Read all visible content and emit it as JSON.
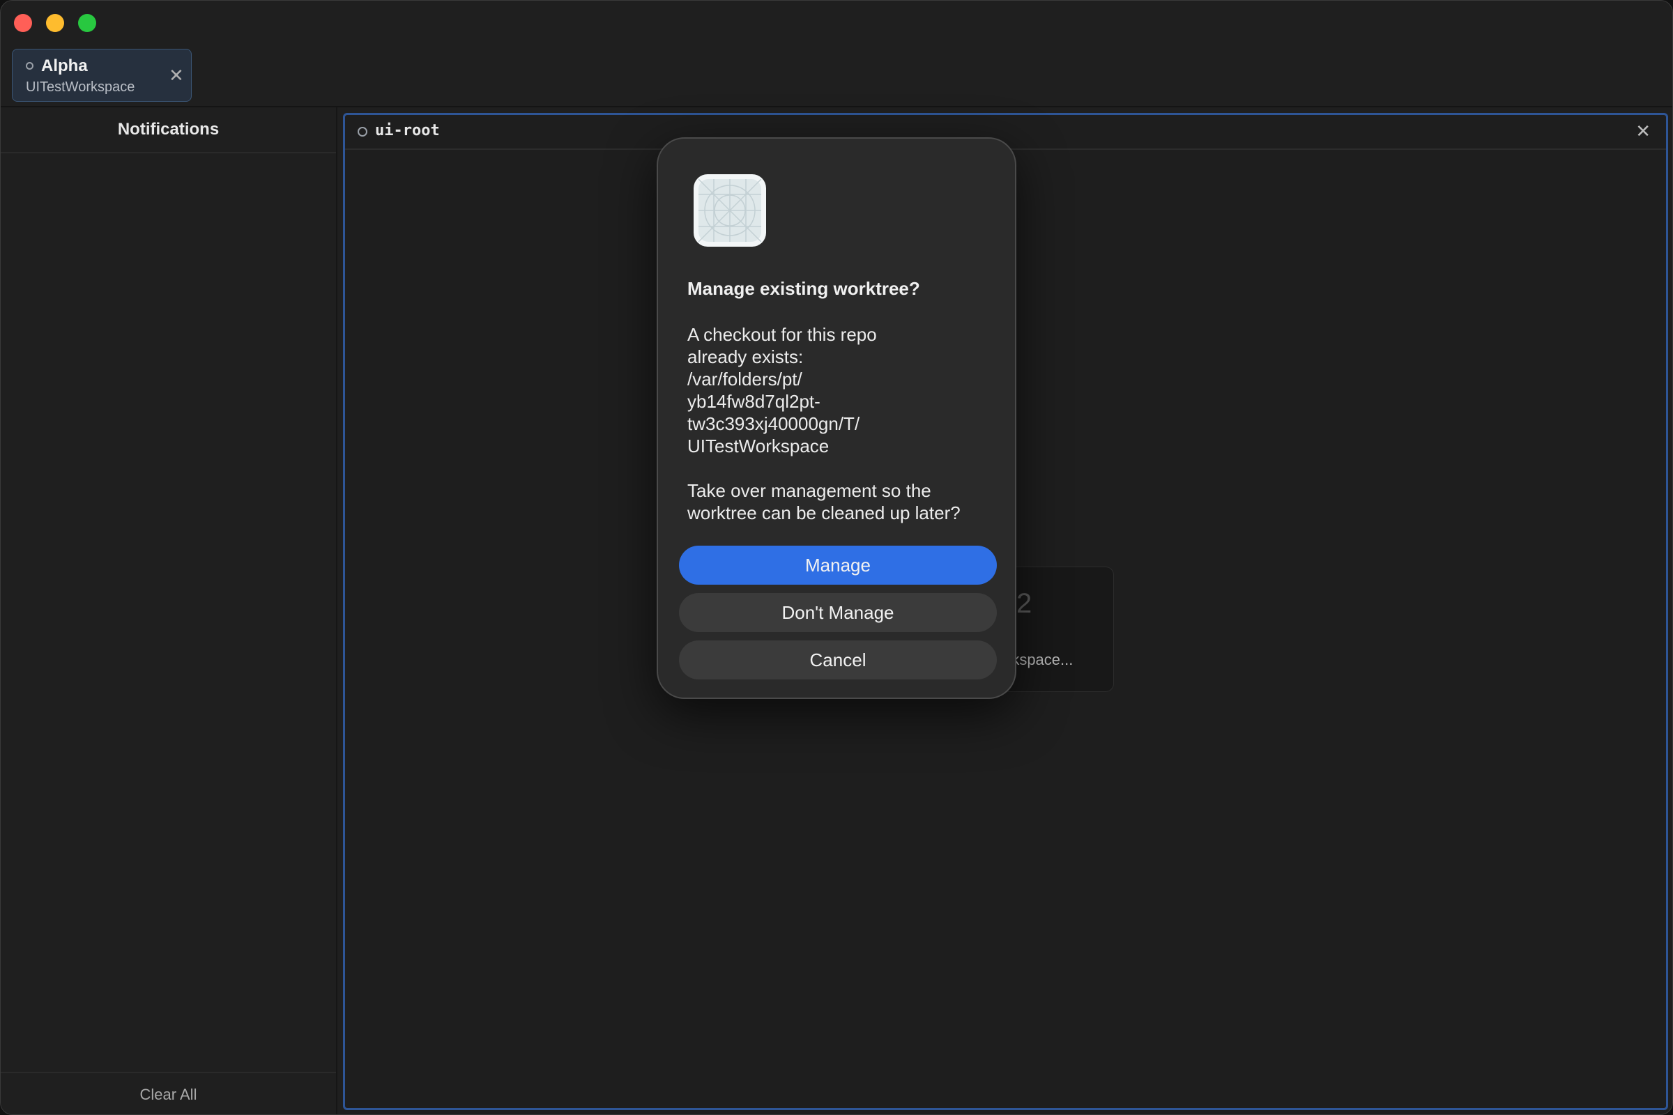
{
  "window": {
    "controls": [
      "close",
      "minimize",
      "maximize"
    ]
  },
  "workspace_tab": {
    "title": "Alpha",
    "subtitle": "UITestWorkspace",
    "close_glyph": "✕"
  },
  "sidebar": {
    "header": "Notifications",
    "footer_button": "Clear All"
  },
  "pane": {
    "name": "ui-root",
    "close_glyph": "✕",
    "background_card_text": "rkspace...",
    "background_card_glyph": "2"
  },
  "dialog": {
    "icon": "app-placeholder-icon",
    "title": "Manage existing worktree?",
    "message": "A checkout for this repo\nalready exists:\n/var/folders/pt/\nyb14fw8d7ql2pt-\ntw3c393xj40000gn/T/\nUITestWorkspace\n\nTake over management so the\nworktree can be cleaned up later?",
    "buttons": {
      "primary": "Manage",
      "secondary": "Don't Manage",
      "cancel": "Cancel"
    }
  },
  "colors": {
    "accent": "#2f6fe5",
    "pane_border": "#2e5596",
    "close": "#ff5f57",
    "minimize": "#febc2e",
    "maximize": "#28c840"
  }
}
